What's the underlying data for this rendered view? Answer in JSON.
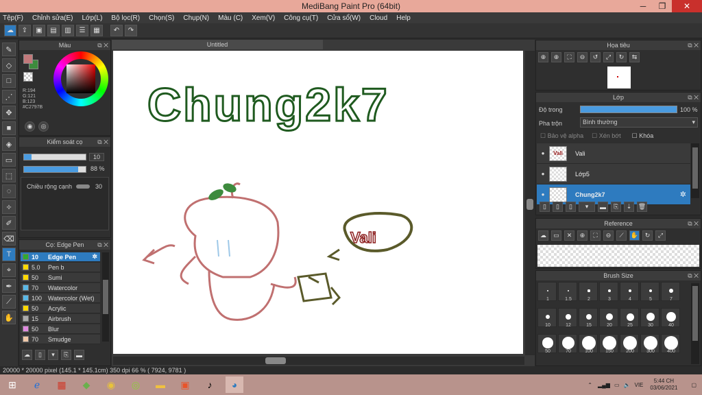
{
  "window": {
    "title": "MediBang Paint Pro (64bit)"
  },
  "menu": [
    "Tệp(F)",
    "Chỉnh sửa(E)",
    "Lớp(L)",
    "Bộ lọc(R)",
    "Chọn(S)",
    "Chụp(N)",
    "Màu (C)",
    "Xem(V)",
    "Công cụ(T)",
    "Cửa sổ(W)",
    "Cloud",
    "Help"
  ],
  "color_panel": {
    "title": "Màu",
    "r": "R:194",
    "g": "G:121",
    "b": "B:123",
    "hex": "#C2797B",
    "main_color": "#c2797b",
    "sub_color": "#3d8b3d"
  },
  "size_panel": {
    "title": "Kiểm soát cọ",
    "size_value": "10",
    "size_fill": 0.12,
    "opacity_value": "88 %",
    "opacity_fill": 0.88,
    "width_label": "Chiều rộng cạnh",
    "width_value": "30"
  },
  "brush_panel": {
    "title": "Cọ: Edge Pen",
    "brushes": [
      {
        "size": "10",
        "name": "Edge Pen",
        "color": "#2faa2f",
        "selected": true
      },
      {
        "size": "5.0",
        "name": "Pen b",
        "color": "#ffd800"
      },
      {
        "size": "50",
        "name": "Sumi",
        "color": "#ffd800"
      },
      {
        "size": "70",
        "name": "Watercolor",
        "color": "#5ab8e6"
      },
      {
        "size": "100",
        "name": "Watercolor (Wet)",
        "color": "#5ab8e6"
      },
      {
        "size": "50",
        "name": "Acrylic",
        "color": "#ffd800"
      },
      {
        "size": "15",
        "name": "Airbrush",
        "color": "#aaaaaa"
      },
      {
        "size": "50",
        "name": "Blur",
        "color": "#e08ae0"
      },
      {
        "size": "70",
        "name": "Smudge",
        "color": "#f0c8a8"
      }
    ]
  },
  "canvas": {
    "tab": "Untitled",
    "text": "Chung2k7",
    "bubble_text": "Vali"
  },
  "navigator": {
    "title": "Họa tiêu"
  },
  "layers": {
    "title": "Lớp",
    "opacity_label": "Độ trong",
    "opacity_value": "100 %",
    "opacity_fill": 1.0,
    "blend_label": "Pha trộn",
    "blend_value": "Bình thường",
    "protect_alpha": "Bảo vệ alpha",
    "clipping": "Xén bớt",
    "lock": "Khóa",
    "items": [
      {
        "name": "Vali",
        "thumb": "Vali"
      },
      {
        "name": "Lớp5",
        "thumb": ""
      },
      {
        "name": "Chung2k7",
        "thumb": "",
        "selected": true
      }
    ]
  },
  "reference": {
    "title": "Reference"
  },
  "brush_size": {
    "title": "Brush Size",
    "sizes": [
      "1",
      "1.5",
      "2",
      "3",
      "4",
      "5",
      "7",
      "10",
      "12",
      "15",
      "20",
      "25",
      "30",
      "40",
      "50",
      "70",
      "100",
      "150",
      "200",
      "300",
      "400"
    ]
  },
  "status": {
    "text": "20000 * 20000 pixel  (145.1 * 145.1cm)  350 dpi  66 %  ( 7924, 9781 )"
  },
  "taskbar": {
    "time": "5:44 CH",
    "date": "03/06/2021",
    "lang": "VIE"
  }
}
